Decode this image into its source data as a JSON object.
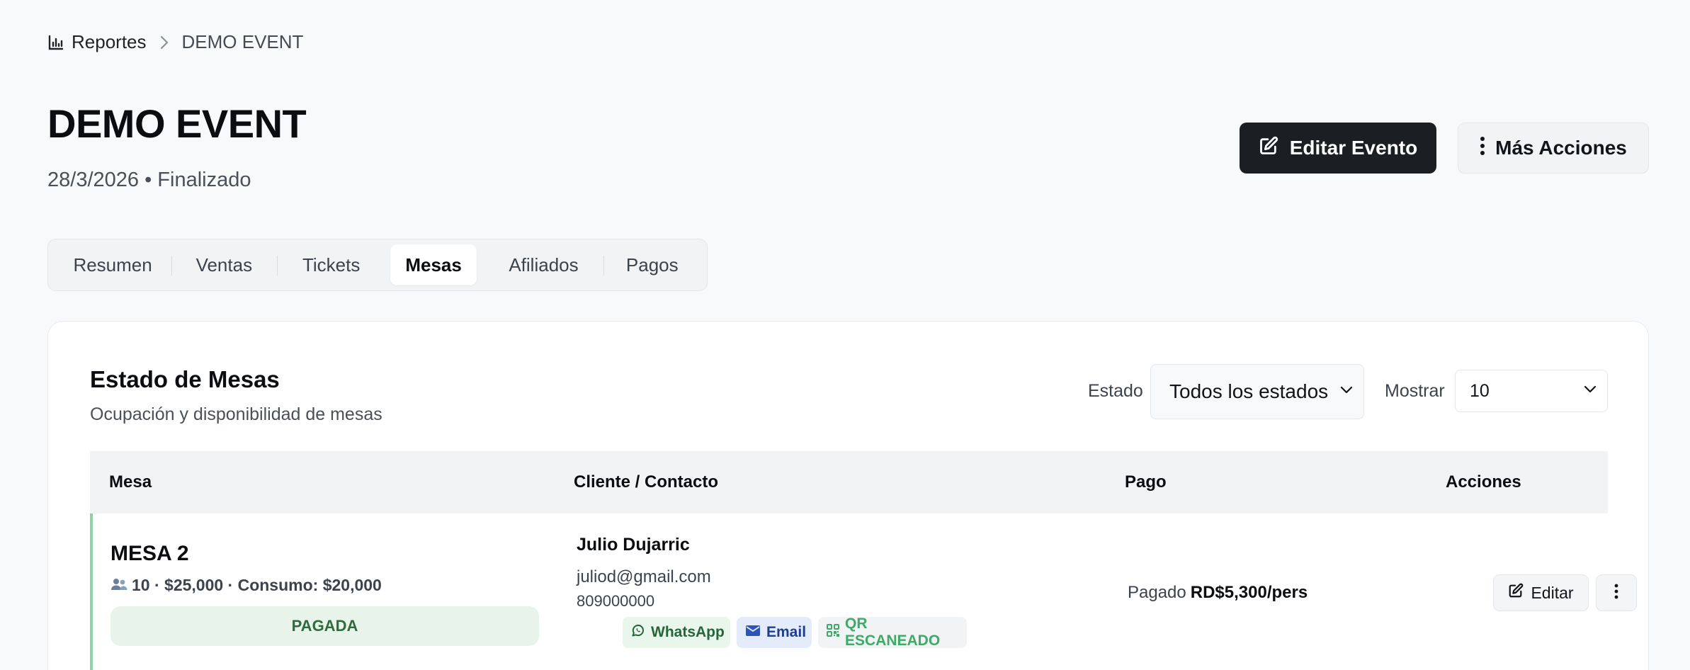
{
  "breadcrumb": {
    "root": "Reportes",
    "current": "DEMO EVENT"
  },
  "header": {
    "title": "DEMO EVENT",
    "subtitle": "28/3/2026 • Finalizado",
    "edit_label": "Editar Evento",
    "more_label": "Más Acciones"
  },
  "tabs": [
    {
      "label": "Resumen"
    },
    {
      "label": "Ventas"
    },
    {
      "label": "Tickets"
    },
    {
      "label": "Mesas",
      "active": true
    },
    {
      "label": "Afiliados"
    },
    {
      "label": "Pagos"
    }
  ],
  "card": {
    "title": "Estado de Mesas",
    "subtitle": "Ocupación y disponibilidad de mesas",
    "filter_label": "Estado",
    "filter_value": "Todos los estados",
    "show_label": "Mostrar",
    "show_value": "10"
  },
  "table": {
    "columns": [
      "Mesa",
      "Cliente / Contacto",
      "Pago",
      "Acciones"
    ],
    "rows": [
      {
        "mesa": "MESA 2",
        "details": "10 · $25,000 · Consumo: $20,000",
        "status": "PAGADA",
        "client": "Julio Dujarric",
        "email": "juliod@gmail.com",
        "phone": "809000000",
        "chips": {
          "whatsapp": "WhatsApp",
          "email": "Email",
          "qr": "QR ESCANEADO"
        },
        "payment_label": "Pagado",
        "payment_amount": "RD$5,300/pers",
        "edit_label": "Editar"
      }
    ]
  },
  "colors": {
    "primary_button": "#1b1f24",
    "paid_badge_bg": "#e8f3ea",
    "paid_badge_text": "#2f6b3f",
    "row_accent": "#8fd3a4",
    "whatsapp": "#26653a",
    "email": "#1f3e8c",
    "qr": "#3eaa67"
  },
  "icons": {
    "breadcrumb": "bar-chart-icon",
    "separator": "chevron-right-icon",
    "edit": "edit-icon",
    "more": "kebab-icon",
    "people": "people-icon",
    "whatsapp": "whatsapp-icon",
    "email": "envelope-icon",
    "qr": "qr-icon",
    "select": "chevron-down-icon"
  }
}
